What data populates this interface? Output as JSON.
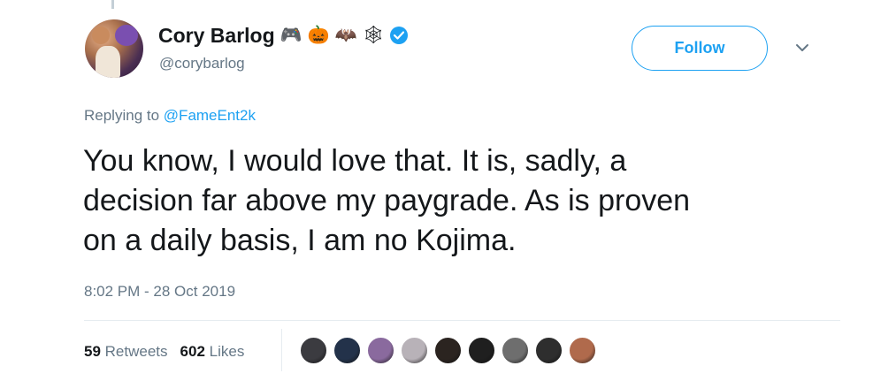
{
  "author": {
    "display_name": "Cory Barlog",
    "handle": "@corybarlog",
    "name_emojis": [
      "🎮",
      "🎃",
      "🦇",
      "🕸"
    ],
    "verified": true
  },
  "follow_button_label": "Follow",
  "replying": {
    "prefix": "Replying to",
    "target": "@FameEnt2k"
  },
  "tweet_text": "You know, I would love that.  It is, sadly, a\ndecision far above my paygrade. As is proven\non a daily basis, I am no Kojima.",
  "timestamp": "8:02 PM - 28 Oct 2019",
  "stats": {
    "retweets_count": "59",
    "retweets_label": "Retweets",
    "likes_count": "602",
    "likes_label": "Likes"
  },
  "liker_avatar_colors": [
    "#3b3b40",
    "#23324a",
    "#8a6a9e",
    "#b8b2b8",
    "#2b2420",
    "#1f1f1f",
    "#6e6e6e",
    "#2e2e2e",
    "#b06a4c"
  ],
  "colors": {
    "accent": "#1da1f2",
    "secondary_text": "#657786",
    "primary_text": "#14171a"
  }
}
